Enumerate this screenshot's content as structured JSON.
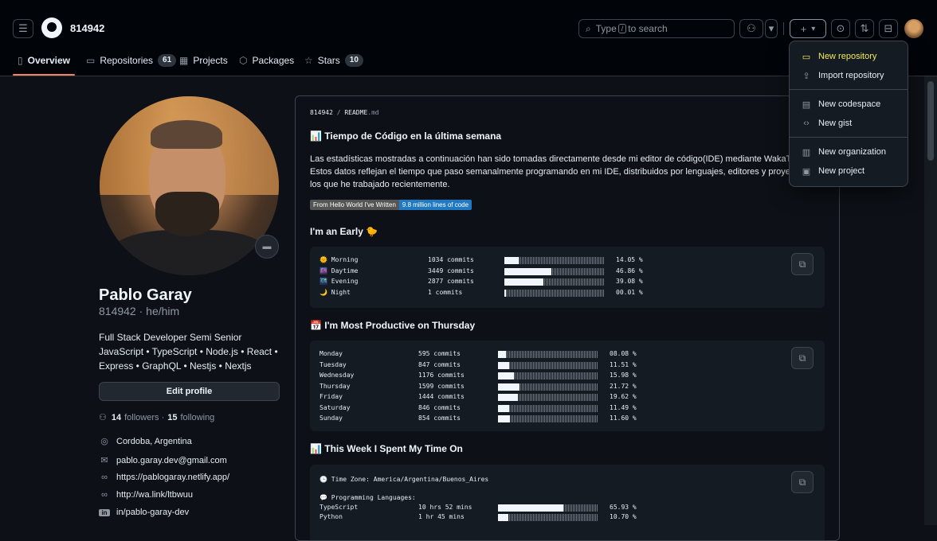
{
  "header": {
    "username": "814942",
    "search_placeholder_pre": "Type",
    "search_key": "/",
    "search_placeholder_post": "to search",
    "plus_label": "+",
    "caret_label": "▾"
  },
  "tabs": [
    {
      "label": "Overview",
      "icon": "book-icon"
    },
    {
      "label": "Repositories",
      "count": "61",
      "icon": "repo-icon"
    },
    {
      "label": "Projects",
      "icon": "table-icon"
    },
    {
      "label": "Packages",
      "icon": "package-icon"
    },
    {
      "label": "Stars",
      "count": "10",
      "icon": "star-icon"
    }
  ],
  "profile": {
    "name": "Pablo Garay",
    "handle": "814942 · he/him",
    "bio": "Full Stack Developer Semi Senior JavaScript • TypeScript • Node.js • React • Express • GraphQL • Nestjs • Nextjs",
    "edit_label": "Edit profile",
    "followers": "14",
    "followers_label": "followers ·",
    "following": "15",
    "following_label": "following",
    "location": "Cordoba, Argentina",
    "email": "pablo.garay.dev@gmail.com",
    "website": "https://pablogaray.netlify.app/",
    "link2": "http://wa.link/ltbwuu",
    "linkedin": "in/pablo-garay-dev"
  },
  "readme": {
    "path_user": "814942",
    "path_sep": " / ",
    "path_file": "README",
    "path_ext": ".md",
    "h_code_time": "📊 Tiempo de Código en la última semana",
    "intro": "Las estadísticas mostradas a continuación han sido tomadas directamente desde mi editor de código(IDE) mediante WakaTime. Estos datos reflejan el tiempo que paso semanalmente programando en mi IDE, distribuidos por lenguajes, editores y proyectos en los que he trabajado recientemente.",
    "badge_left": "From Hello World I've Written",
    "badge_right": "9.8 million lines of code",
    "h_early": "I'm an Early 🐤",
    "h_productive": "📅 I'm Most Productive on Thursday",
    "h_week": "📊 This Week I Spent My Time On",
    "timezone": "🕒 Time Zone: America/Argentina/Buenos_Aires",
    "prog_lang": "💬 Programming Languages:"
  },
  "time_of_day": [
    {
      "label": "🌞 Morning",
      "count": "1034 commits",
      "pct": "14.05 %",
      "fraction": 0.1405
    },
    {
      "label": "🌆 Daytime",
      "count": "3449 commits",
      "pct": "46.86 %",
      "fraction": 0.4686
    },
    {
      "label": "🌃 Evening",
      "count": "2877 commits",
      "pct": "39.08 %",
      "fraction": 0.3908
    },
    {
      "label": "🌙 Night",
      "count": "1 commits",
      "pct": "00.01 %",
      "fraction": 0.0001
    }
  ],
  "weekdays": [
    {
      "label": "Monday",
      "count": "595 commits",
      "pct": "08.08 %",
      "fraction": 0.0808
    },
    {
      "label": "Tuesday",
      "count": "847 commits",
      "pct": "11.51 %",
      "fraction": 0.1151
    },
    {
      "label": "Wednesday",
      "count": "1176 commits",
      "pct": "15.98 %",
      "fraction": 0.1598
    },
    {
      "label": "Thursday",
      "count": "1599 commits",
      "pct": "21.72 %",
      "fraction": 0.2172
    },
    {
      "label": "Friday",
      "count": "1444 commits",
      "pct": "19.62 %",
      "fraction": 0.1962
    },
    {
      "label": "Saturday",
      "count": "846 commits",
      "pct": "11.49 %",
      "fraction": 0.1149
    },
    {
      "label": "Sunday",
      "count": "854 commits",
      "pct": "11.60 %",
      "fraction": 0.116
    }
  ],
  "languages": [
    {
      "label": "TypeScript",
      "count": "10 hrs 52 mins",
      "pct": "65.93 %",
      "fraction": 0.6593
    },
    {
      "label": "Python",
      "count": "1 hr 45 mins",
      "pct": "10.70 %",
      "fraction": 0.107
    }
  ],
  "menu": [
    {
      "label": "New repository",
      "icon": "repo-icon",
      "active": true
    },
    {
      "label": "Import repository",
      "icon": "repo-push-icon"
    },
    {
      "label": "New codespace",
      "icon": "codespaces-icon"
    },
    {
      "label": "New gist",
      "icon": "code-icon"
    },
    {
      "label": "New organization",
      "icon": "organization-icon"
    },
    {
      "label": "New project",
      "icon": "project-icon"
    }
  ],
  "colors": {
    "accent_underline": "#f78166",
    "menu_highlight": "#f3e95a",
    "badge_blue": "#1f7ac3",
    "background": "#0d1117"
  }
}
